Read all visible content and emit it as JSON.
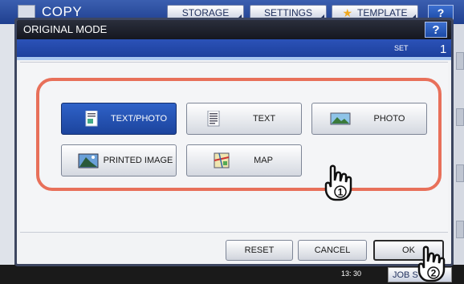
{
  "background": {
    "app_title": "COPY",
    "tabs": [
      "STORAGE",
      "SETTINGS",
      "TEMPLATE"
    ],
    "help_label": "?",
    "time": "13: 30",
    "job_label": "JOB S"
  },
  "dialog": {
    "title": "ORIGINAL MODE",
    "help_label": "?",
    "set_label": "SET",
    "set_count": "1",
    "modes": [
      {
        "label": "TEXT/PHOTO",
        "icon": "text-photo-icon",
        "selected": true
      },
      {
        "label": "TEXT",
        "icon": "text-icon",
        "selected": false
      },
      {
        "label": "PHOTO",
        "icon": "photo-icon",
        "selected": false
      },
      {
        "label": "PRINTED IMAGE",
        "icon": "printed-image-icon",
        "selected": false
      },
      {
        "label": "MAP",
        "icon": "map-icon",
        "selected": false
      }
    ],
    "actions": {
      "reset": "RESET",
      "cancel": "CANCEL",
      "ok": "OK"
    }
  },
  "annotations": {
    "step1": "1",
    "step2": "2",
    "highlight_color": "#e8705a"
  },
  "colors": {
    "selected_button": "#2f62c8",
    "set_bar": "#1b3d97",
    "title_bar": "#15171f"
  }
}
